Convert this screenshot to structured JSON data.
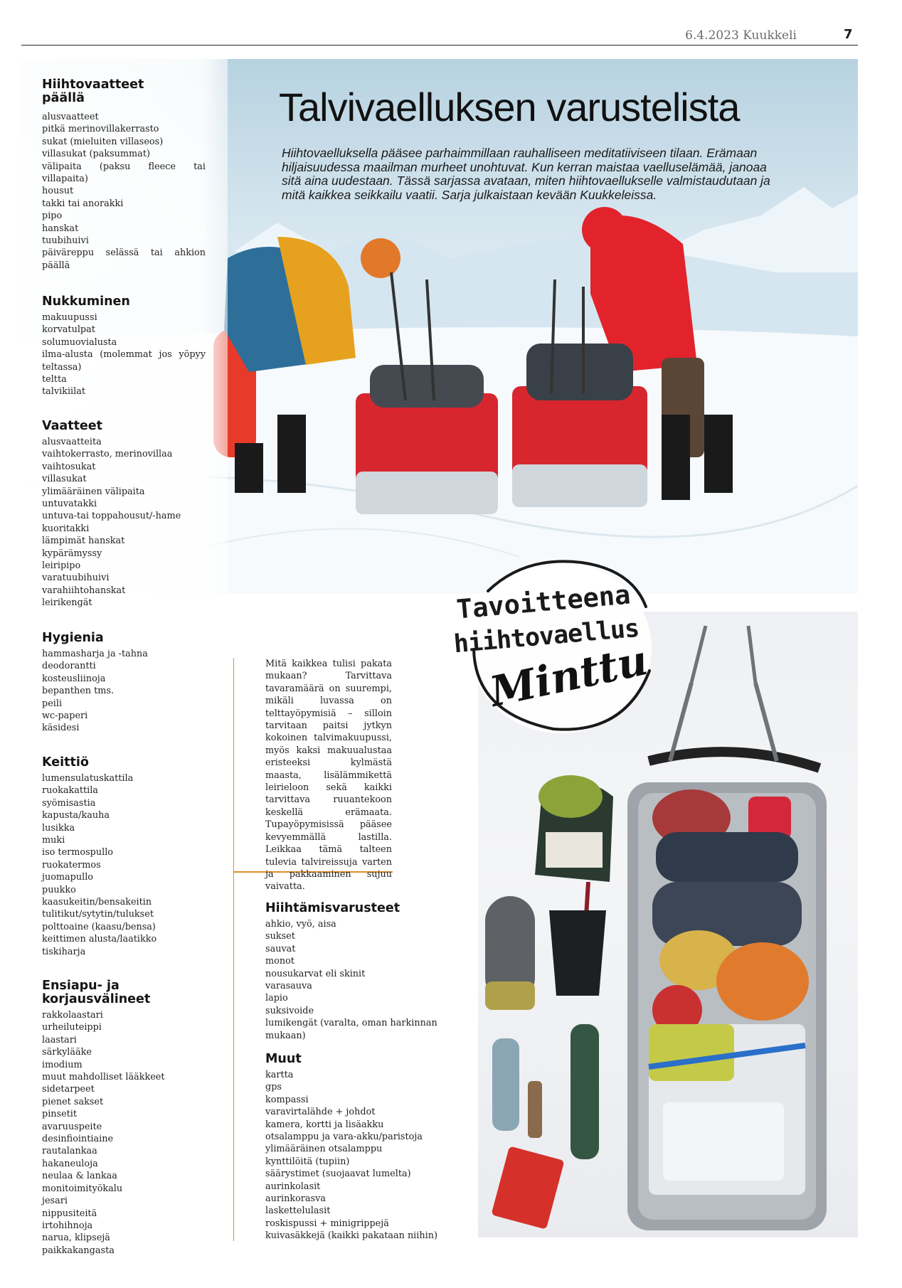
{
  "header": {
    "date_paper": "6.4.2023 Kuukkeli",
    "page_number": "7"
  },
  "article": {
    "title": "Talvivaelluksen varustelista",
    "lede": "Hiihtovaelluksella pääsee parhaimmillaan rauhalliseen meditatiiviseen tilaan. Erämaan hiljaisuudessa maailman murheet unohtuvat. Kun kerran maistaa vaelluselämää, janoaa sitä aina uudestaan. Tässä sarjassa avataan, miten hiihtovaellukselle valmistaudutaan ja mitä kaikkea seikkailu vaatii. Sarja julkaistaan kevään Kuukkeleissa.",
    "body": "Mitä kaikkea tulisi pakata mukaan? Tarvittava tavaramäärä on suurempi, mikäli luvassa on telttayöpymisiä – silloin tarvitaan paitsi jytkyn kokoinen talvimakuupussi, myös kaksi makuualustaa eristeeksi kylmästä maasta, lisälämmikettä leirieloon sekä kaikki tarvittava ruuantekoon keskellä erämaata. Tupayöpymisissä pääsee kevyemmällä lastilla. Leikkaa tämä talteen tulevia talvireissuja varten ja pakkaaminen sujuu vaivatta."
  },
  "badge": {
    "line1": "Tavoitteena",
    "line2": "hiihtovaellus",
    "signature": "Minttu"
  },
  "sections": {
    "hiihtovaatteet": {
      "heading_line1": "Hiihtovaatteet",
      "heading_line2": "päällä",
      "items": [
        "alusvaatteet",
        "pitkä merinovillakerrasto",
        "sukat (mieluiten villaseos)",
        "villasukat (paksummat)",
        "välipaita (paksu fleece tai villapaita)",
        "housut",
        "takki tai anorakki",
        "pipo",
        "hanskat",
        "tuubihuivi",
        "päiväreppu selässä tai ahkion päällä"
      ]
    },
    "nukkuminen": {
      "heading": "Nukkuminen",
      "items": [
        "makuupussi",
        "korvatulpat",
        "solumuovialusta",
        "ilma-alusta (molemmat jos yöpyy teltassa)",
        "teltta",
        "talvikiilat"
      ]
    },
    "vaatteet": {
      "heading": "Vaatteet",
      "items": [
        "alusvaatteita",
        "vaihtokerrasto, merinovillaa",
        "vaihtosukat",
        "villasukat",
        "ylimääräinen välipaita",
        "untuvatakki",
        "untuva-tai toppahousut/-hame",
        "kuoritakki",
        "lämpimät hanskat",
        "kypärämyssy",
        "leiripipo",
        "varatuubihuivi",
        "varahiihtohanskat",
        "leirikengät"
      ]
    },
    "hygienia": {
      "heading": "Hygienia",
      "items": [
        "hammasharja ja -tahna",
        "deodorantti",
        "kosteusliinoja",
        "bepanthen tms.",
        "peili",
        "wc-paperi",
        "käsidesi"
      ]
    },
    "keittio": {
      "heading": "Keittiö",
      "items": [
        "lumensulatuskattila",
        "ruokakattila",
        "syömisastia",
        "kapusta/kauha",
        "lusikka",
        "muki",
        "iso termospullo",
        "ruokatermos",
        "juomapullo",
        "puukko",
        "kaasukeitin/bensakeitin",
        "tulitikut/sytytin/tulukset",
        "polttoaine (kaasu/bensa)",
        "keittimen alusta/laatikko",
        "tiskiharja"
      ]
    },
    "ensiapu": {
      "heading": "Ensiapu- ja korjausvälineet",
      "items": [
        "rakkolaastari",
        "urheiluteippi",
        "laastari",
        "särkylääke",
        "imodium",
        "muut mahdolliset lääkkeet",
        "sidetarpeet",
        "pienet sakset",
        "pinsetit",
        "avaruuspeite",
        "desinfiointiaine",
        "rautalankaa",
        "hakaneuloja",
        "neulaa & lankaa",
        "monitoimityökalu",
        "jesari",
        "nippusiteitä",
        "irtohihnoja",
        "narua, klipsejä",
        "paikkakangasta"
      ]
    },
    "hiihtamis": {
      "heading": "Hiihtämisvarusteet",
      "items": [
        "ahkio, vyö, aisa",
        "sukset",
        "sauvat",
        "monot",
        "nousukarvat eli skinit",
        "varasauva",
        "lapio",
        "suksivoide",
        "lumikengät (varalta, oman harkinnan mukaan)"
      ]
    },
    "muut": {
      "heading": "Muut",
      "items": [
        "kartta",
        "gps",
        "kompassi",
        "varavirtalähde + johdot",
        "kamera, kortti ja lisäakku",
        "otsalamppu ja vara-akku/paristoja",
        "ylimääräinen otsalamppu",
        "kynttilöitä (tupiin)",
        "säärystimet (suojaavat lumelta)",
        "aurinkolasit",
        "aurinkorasva",
        "laskettelulasit",
        "roskispussi + minigrippejä",
        "kuivasäkkejä (kaikki pakataan niihin)"
      ]
    }
  },
  "colors": {
    "accent_rule": "#e08e2c",
    "jacket_red": "#e2232c",
    "jacket_yellow": "#e6a21f",
    "sky": "#b7d2e0"
  }
}
